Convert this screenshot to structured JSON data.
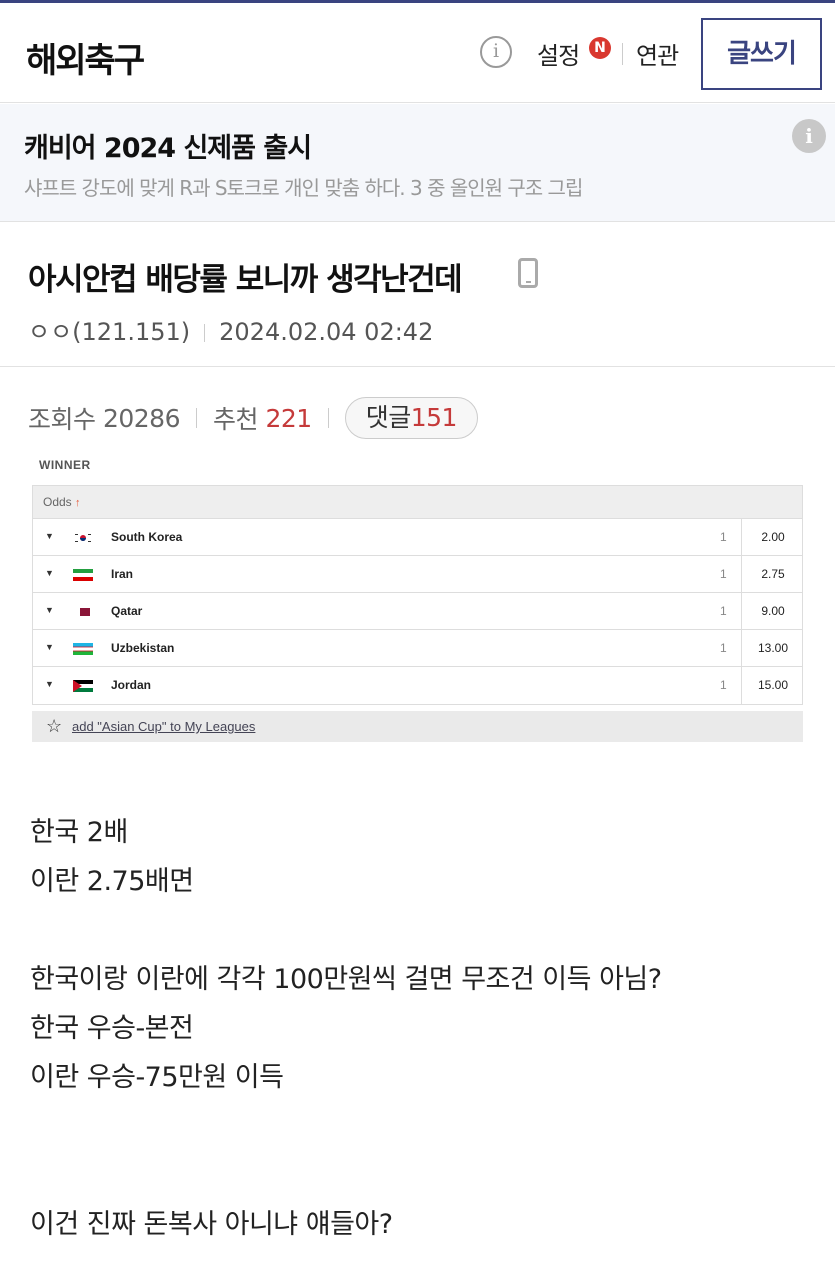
{
  "header": {
    "board_title": "해외축구",
    "settings_label": "설정",
    "new_badge": "N",
    "related_label": "연관",
    "write_button": "글쓰기"
  },
  "ad": {
    "title": "캐비어 2024 신제품 출시",
    "description": "샤프트 강도에 맞게 R과 S토크로 개인 맞춤 하다. 3 중 올인원 구조 그립"
  },
  "post": {
    "title": "아시안컵 배당률 보니까 생각난건데",
    "author": "ㅇㅇ(121.151)",
    "datetime": "2024.02.04 02:42",
    "views_label": "조회수",
    "views": "20286",
    "recommend_label": "추천",
    "recommend": "221",
    "comments_label": "댓글",
    "comments": "151"
  },
  "odds_image": {
    "winner_label": "WINNER",
    "odds_header": "Odds",
    "rows": [
      {
        "team": "South Korea",
        "one": "1",
        "price": "2.00"
      },
      {
        "team": "Iran",
        "one": "1",
        "price": "2.75"
      },
      {
        "team": "Qatar",
        "one": "1",
        "price": "9.00"
      },
      {
        "team": "Uzbekistan",
        "one": "1",
        "price": "13.00"
      },
      {
        "team": "Jordan",
        "one": "1",
        "price": "15.00"
      }
    ],
    "add_league": "add \"Asian Cup\" to My Leagues"
  },
  "body_lines": [
    "한국 2배",
    "이란 2.75배면",
    "",
    "한국이랑 이란에 각각 100만원씩 걸면 무조건 이득 아님?",
    "한국 우승-본전",
    "이란 우승-75만원 이득",
    "",
    "",
    "이건 진짜 돈복사 아니냐 얘들아?"
  ],
  "colors": {
    "accent": "#3a4480",
    "count_red": "#c53a3a",
    "badge_red": "#d9382f"
  }
}
